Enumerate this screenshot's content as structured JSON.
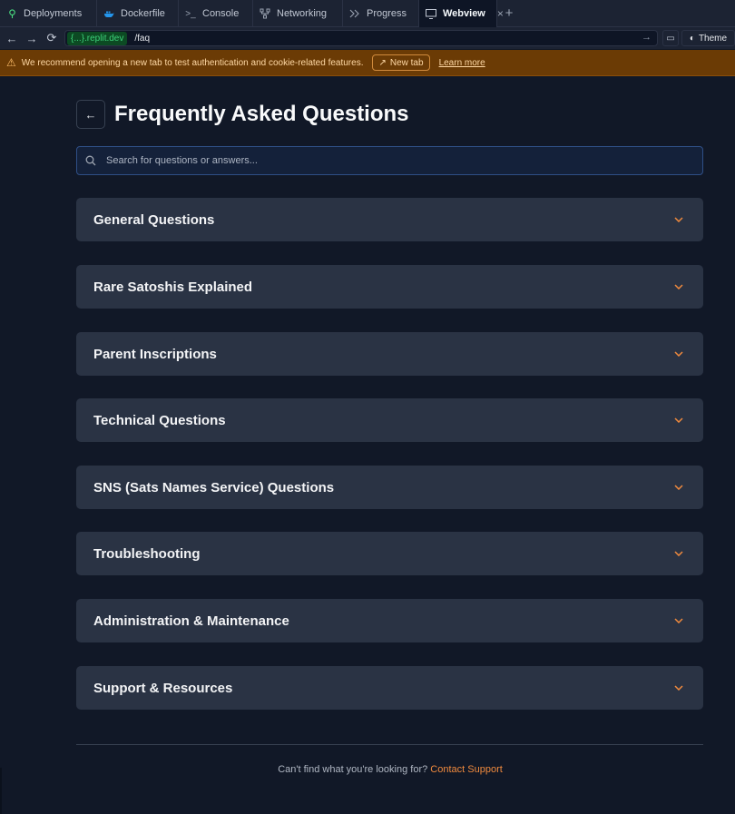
{
  "tabs": [
    {
      "label": "Deployments",
      "icon": "deployments-icon"
    },
    {
      "label": "Dockerfile",
      "icon": "docker-icon"
    },
    {
      "label": "Console",
      "icon": "console-icon"
    },
    {
      "label": "Networking",
      "icon": "network-icon"
    },
    {
      "label": "Progress",
      "icon": "progress-icon"
    },
    {
      "label": "Webview",
      "icon": "monitor-icon",
      "active": true
    }
  ],
  "address": {
    "domain": "{...}.replit.dev",
    "path": "/faq",
    "theme_label": "Theme"
  },
  "banner": {
    "message": "We recommend opening a new tab to test authentication and cookie-related features.",
    "new_tab_label": "New tab",
    "learn_more_label": "Learn more"
  },
  "page": {
    "title": "Frequently Asked Questions",
    "search_placeholder": "Search for questions or answers...",
    "sections": [
      "General Questions",
      "Rare Satoshis Explained",
      "Parent Inscriptions",
      "Technical Questions",
      "SNS (Sats Names Service) Questions",
      "Troubleshooting",
      "Administration & Maintenance",
      "Support & Resources"
    ],
    "footer_text": "Can't find what you're looking for?",
    "footer_link": "Contact Support"
  },
  "colors": {
    "background": "#111827",
    "card": "#2a3344",
    "accent": "#f08a3e",
    "banner": "#6b3b05"
  }
}
